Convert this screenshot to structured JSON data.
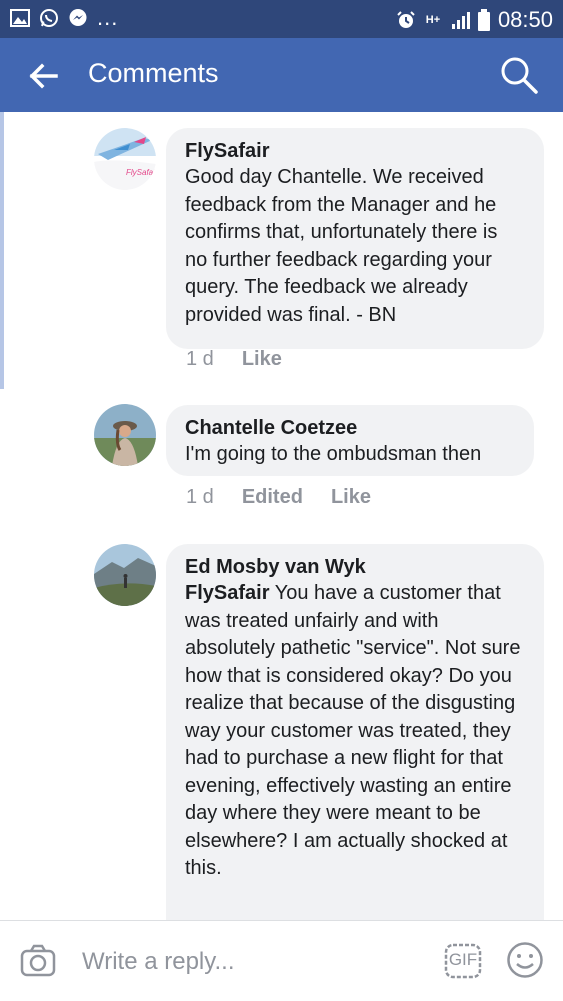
{
  "status_bar": {
    "time": "08:50",
    "dots": "...",
    "network_label": "H+",
    "icons": [
      "gallery-icon",
      "whatsapp-icon",
      "messenger-icon",
      "alarm-icon",
      "network-icon",
      "signal-icon",
      "battery-icon"
    ]
  },
  "app_bar": {
    "title": "Comments",
    "back_icon": "back-arrow-icon",
    "search_icon": "search-icon"
  },
  "comments": [
    {
      "author": "FlySafair",
      "text": "Good day Chantelle. We received feedback from the Manager and he confirms that, unfortunately there is no further feedback regarding your query. The feedback we already provided was final. - BN",
      "time": "1 d",
      "edited": "",
      "like_label": "Like"
    },
    {
      "author": "Chantelle Coetzee",
      "text": "I'm going to the ombudsman then",
      "time": "1 d",
      "edited": "Edited",
      "like_label": "Like"
    },
    {
      "author": "Ed Mosby van Wyk",
      "mention": "FlySafair",
      "text": "You have a customer that was treated unfairly and with absolutely pathetic \"service\". Not sure how that is considered okay? Do you realize that because of the disgusting way your customer was treated, they had to purchase a new flight for that evening, effectively wasting an entire day where they were meant to be elsewhere? I am actually shocked at this.",
      "time": "",
      "edited": "",
      "like_label": ""
    }
  ],
  "logo_text": "FlySafair",
  "reply_bar": {
    "placeholder": "Write a reply...",
    "gif_label": "GIF",
    "camera_icon": "camera-icon",
    "emoji_icon": "emoji-icon"
  },
  "colors": {
    "status_bar": "#2f477a",
    "app_bar": "#4267b2",
    "bubble": "#f1f2f4",
    "meta_text": "#90949c",
    "highlight": "#b6c6e6"
  }
}
